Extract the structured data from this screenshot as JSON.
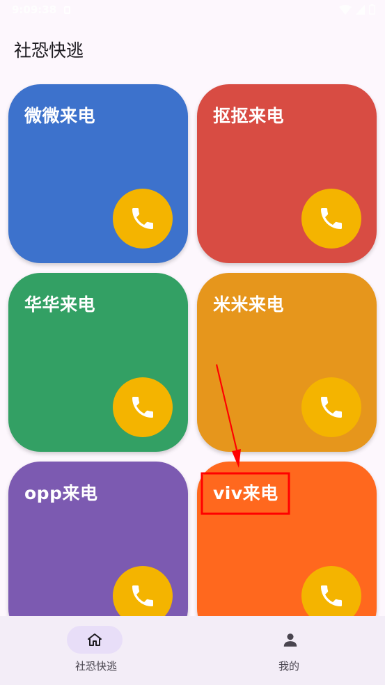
{
  "status_bar": {
    "time": "9:09:38"
  },
  "header": {
    "title": "社恐快逃"
  },
  "cards": [
    {
      "label": "微微来电",
      "color": "#3d72cc",
      "call_icon": "phone-icon"
    },
    {
      "label": "抠抠来电",
      "color": "#d84c43",
      "call_icon": "phone-icon"
    },
    {
      "label": "华华来电",
      "color": "#33a064",
      "call_icon": "phone-icon"
    },
    {
      "label": "米米来电",
      "color": "#e6961c",
      "call_icon": "phone-icon"
    },
    {
      "label": "opp来电",
      "color": "#7c5ab1",
      "call_icon": "phone-icon"
    },
    {
      "label": "viv来电",
      "color": "#ff681e",
      "call_icon": "phone-icon"
    }
  ],
  "call_button_color": "#f4b400",
  "annotation_color": "#ff0000",
  "bottom_nav": {
    "items": [
      {
        "label": "社恐快逃",
        "icon": "home-icon",
        "active": true
      },
      {
        "label": "我的",
        "icon": "person-icon",
        "active": false
      }
    ]
  }
}
